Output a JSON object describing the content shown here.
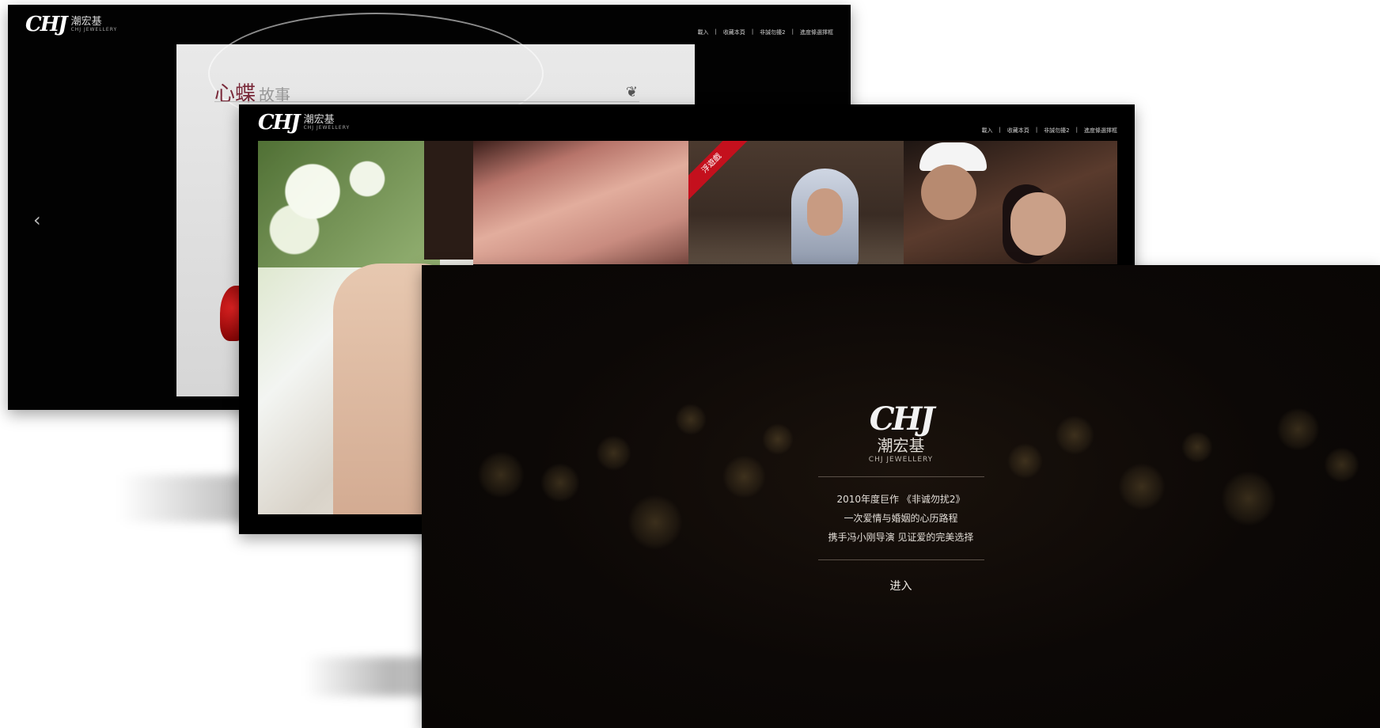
{
  "windows": {
    "back": {
      "logo_mark": "CHJ",
      "logo_cn": "潮宏基",
      "logo_en": "CHJ JEWELLERY",
      "nav": [
        "載入",
        "|",
        "收藏本頁",
        "|",
        "非誠勿擾2",
        "|",
        "進度條選擇框"
      ],
      "arrow_left": "‹",
      "story_title": "心蝶",
      "story_sub": "故事",
      "butterfly": "❦"
    },
    "middle": {
      "logo_mark": "CHJ",
      "logo_cn": "潮宏基",
      "logo_en": "CHJ JEWELLERY",
      "nav": [
        "載入",
        "|",
        "收藏本頁",
        "|",
        "非誠勿擾2",
        "|",
        "進度條選擇框"
      ],
      "badge": "浮遊戲"
    },
    "front": {
      "logo_mark": "CHJ",
      "logo_cn": "潮宏基",
      "logo_en": "CHJ JEWELLERY",
      "lines": [
        "2010年度巨作 《非诚勿扰2》",
        "一次爱情与婚姻的心历路程",
        "携手冯小刚导演 见证爱的完美选择"
      ],
      "enter_label": "进入"
    }
  },
  "colors": {
    "background": "#ffffff",
    "window_bg": "#050303",
    "accent_red": "#c4101d",
    "story_title": "#7a2a3a"
  },
  "icons": [
    "chevron-left-icon",
    "butterfly-icon"
  ]
}
